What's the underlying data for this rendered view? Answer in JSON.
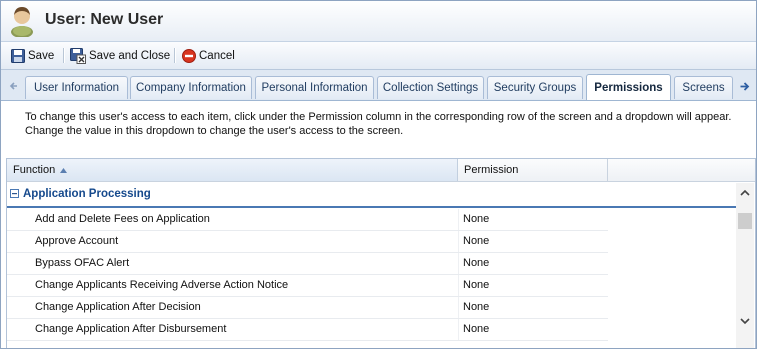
{
  "window": {
    "title": "User: New User",
    "icon": "user-icon"
  },
  "toolbar": {
    "save_label": "Save",
    "save_close_label": "Save and Close",
    "cancel_label": "Cancel"
  },
  "tabs": [
    {
      "label": "User Information",
      "active": false
    },
    {
      "label": "Company Information",
      "active": false
    },
    {
      "label": "Personal Information",
      "active": false
    },
    {
      "label": "Collection Settings",
      "active": false
    },
    {
      "label": "Security Groups",
      "active": false
    },
    {
      "label": "Permissions",
      "active": true
    },
    {
      "label": "Screens",
      "active": false
    }
  ],
  "instructions": {
    "line1": "To change this user's access to each item, click under the Permission column in the corresponding row of the screen and a dropdown will appear.",
    "line2": "Change the value in this dropdown to change the user's access to the screen."
  },
  "grid": {
    "columns": [
      "Function",
      "Permission"
    ],
    "sorted_column": "Function",
    "sort_direction": "ascending",
    "group": "Application Processing",
    "rows": [
      {
        "function": "Add and Delete Fees on Application",
        "permission": "None"
      },
      {
        "function": "Approve Account",
        "permission": "None"
      },
      {
        "function": "Bypass OFAC Alert",
        "permission": "None"
      },
      {
        "function": "Change Applicants Receiving Adverse Action Notice",
        "permission": "None"
      },
      {
        "function": "Change Application After Decision",
        "permission": "None"
      },
      {
        "function": "Change Application After Disbursement",
        "permission": "None"
      }
    ]
  },
  "colors": {
    "accent": "#15498c",
    "group_line": "#4a78b3",
    "tab_border": "#9fb6d2",
    "cancel_red": "#d9341f"
  }
}
